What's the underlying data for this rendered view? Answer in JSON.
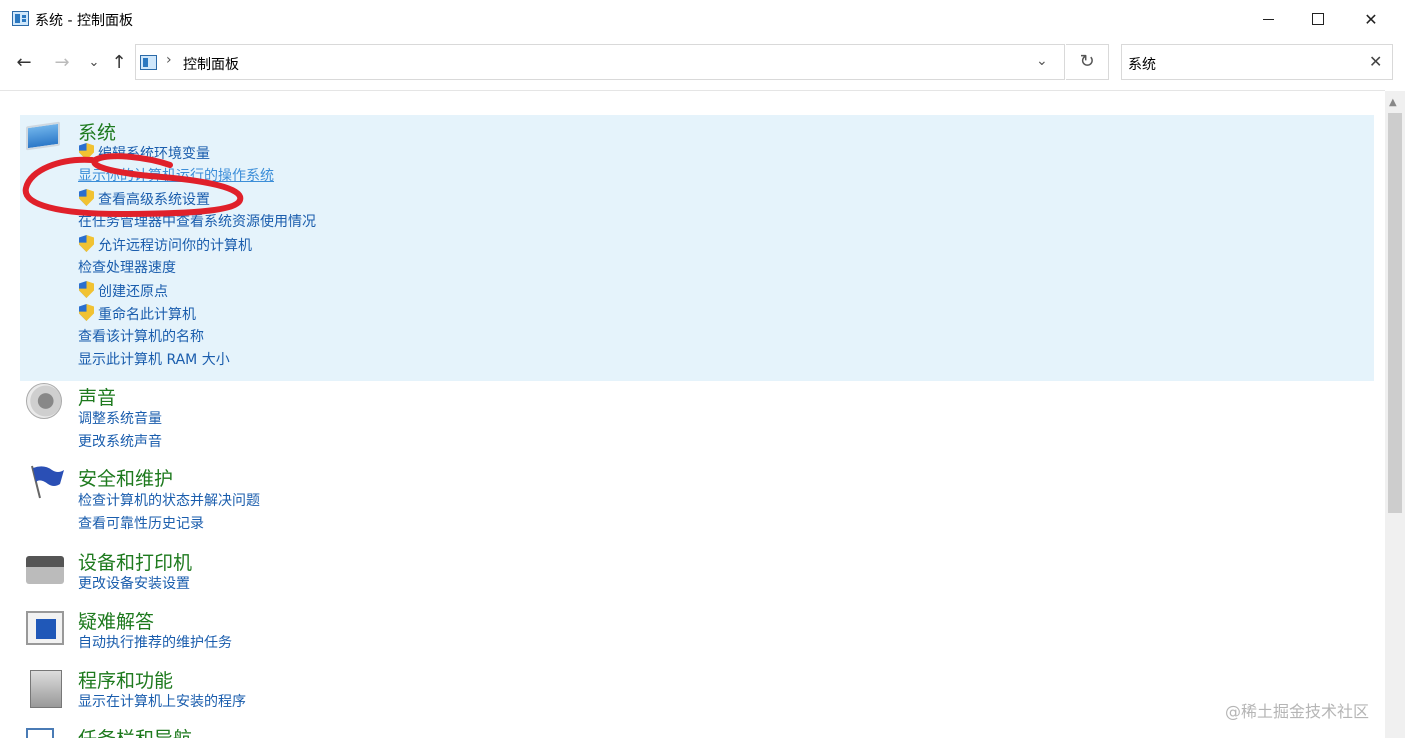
{
  "window": {
    "title": "系统 - 控制面板"
  },
  "nav": {
    "back": "←",
    "forward": "→",
    "recent": "⌄",
    "up": "↑",
    "breadcrumb_sep": "›",
    "breadcrumb": "控制面板",
    "dropdown": "⌄",
    "refresh": "↻"
  },
  "search": {
    "value": "系统",
    "clear": "✕"
  },
  "groups": [
    {
      "title": "系统",
      "icon": "system-icon",
      "links": [
        {
          "label": "编辑系统环境变量",
          "shield": true
        },
        {
          "label": "显示你的计算机运行的操作系统",
          "shield": false,
          "hover": true
        },
        {
          "label": "查看高级系统设置",
          "shield": true
        },
        {
          "label": "在任务管理器中查看系统资源使用情况",
          "shield": false
        },
        {
          "label": "允许远程访问你的计算机",
          "shield": true
        },
        {
          "label": "检查处理器速度",
          "shield": false
        },
        {
          "label": "创建还原点",
          "shield": true
        },
        {
          "label": "重命名此计算机",
          "shield": true
        },
        {
          "label": "查看该计算机的名称",
          "shield": false
        },
        {
          "label": "显示此计算机 RAM 大小",
          "shield": false
        }
      ]
    },
    {
      "title": "声音",
      "icon": "speaker-icon",
      "links": [
        {
          "label": "调整系统音量"
        },
        {
          "label": "更改系统声音"
        }
      ]
    },
    {
      "title": "安全和维护",
      "icon": "flag-icon",
      "links": [
        {
          "label": "检查计算机的状态并解决问题"
        },
        {
          "label": "查看可靠性历史记录"
        }
      ]
    },
    {
      "title": "设备和打印机",
      "icon": "printer-icon",
      "links": [
        {
          "label": "更改设备安装设置"
        }
      ]
    },
    {
      "title": "疑难解答",
      "icon": "troubleshoot-icon",
      "links": [
        {
          "label": "自动执行推荐的维护任务"
        }
      ]
    },
    {
      "title": "程序和功能",
      "icon": "programs-icon",
      "links": [
        {
          "label": "显示在计算机上安装的程序"
        }
      ]
    },
    {
      "title": "任务栏和导航",
      "icon": "taskbar-icon",
      "links": []
    }
  ],
  "watermark": "@稀土掘金技术社区",
  "colors": {
    "selected_bg": "#e5f3fb",
    "title_green": "#1e7a1e",
    "link_blue": "#1a5dad",
    "annotation_red": "#e0202a"
  }
}
